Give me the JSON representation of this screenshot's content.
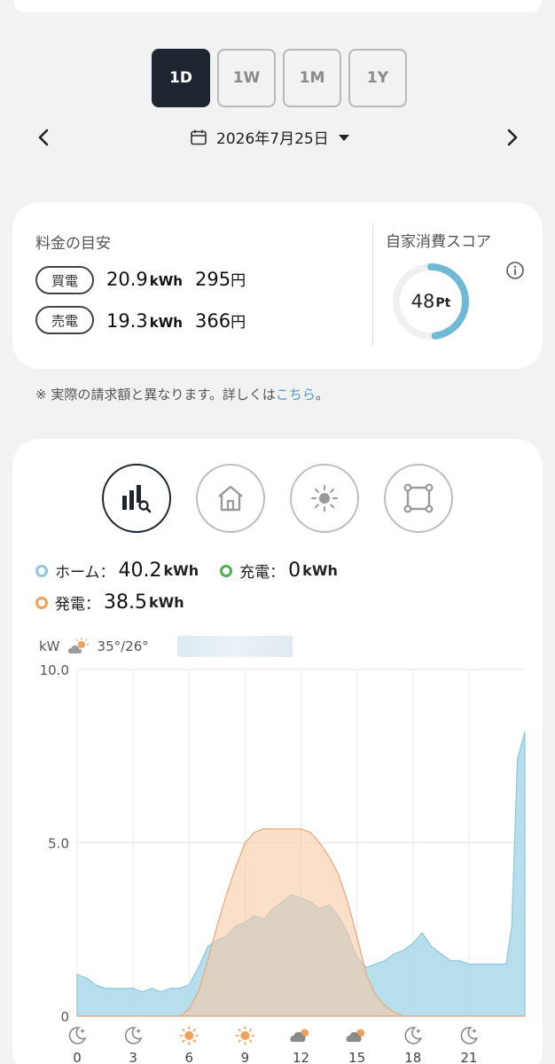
{
  "period_tabs": [
    {
      "label": "1D",
      "active": true
    },
    {
      "label": "1W",
      "active": false
    },
    {
      "label": "1M",
      "active": false
    },
    {
      "label": "1Y",
      "active": false
    }
  ],
  "date": {
    "text": "2026年7月25日"
  },
  "cost": {
    "title": "料金の目安",
    "buy": {
      "pill": "買電",
      "kwh": "20.9",
      "kwh_unit": "kWh",
      "yen": "295",
      "yen_unit": "円"
    },
    "sell": {
      "pill": "売電",
      "kwh": "19.3",
      "kwh_unit": "kWh",
      "yen": "366",
      "yen_unit": "円"
    }
  },
  "score": {
    "title": "自家消費スコア",
    "value": "48",
    "unit": "Pt",
    "ratio": 0.48
  },
  "note": {
    "text": "※ 実際の請求額と異なります。詳しくは",
    "link": "こちら",
    "suffix": "。"
  },
  "legend": {
    "home": {
      "label": "ホーム：",
      "value": "40.2",
      "unit": "kWh",
      "color": "#8cc8e0"
    },
    "charge": {
      "label": "充電：",
      "value": "0",
      "unit": "kWh",
      "color": "#4caf50"
    },
    "gen": {
      "label": "発電：",
      "value": "38.5",
      "unit": "kWh",
      "color": "#f0a05a"
    }
  },
  "weather": {
    "unit": "kW",
    "temps": "35°/26°"
  },
  "colors": {
    "home_fill": "#a9d8ea",
    "gen_fill": "#f6c9a5",
    "overlap": "#d8ccc0"
  },
  "chart_data": {
    "type": "area",
    "ylabel": "kW",
    "ylim": [
      0,
      10
    ],
    "y_ticks": [
      "10.0",
      "5.0",
      "0"
    ],
    "x_ticks": [
      "0",
      "3",
      "6",
      "9",
      "12",
      "15",
      "18",
      "21"
    ],
    "x_tick_weather": [
      "moon",
      "moon",
      "sun",
      "sun",
      "cloud-sun",
      "cloud-sun",
      "moon",
      "moon"
    ],
    "xlim": [
      0,
      24
    ],
    "series": [
      {
        "name": "ホーム",
        "x": [
          0,
          0.5,
          1,
          1.5,
          2,
          2.5,
          3,
          3.5,
          4,
          4.5,
          5,
          5.5,
          6,
          6.5,
          7,
          7.5,
          8,
          8.5,
          9,
          9.5,
          10,
          10.5,
          11,
          11.5,
          12,
          12.5,
          13,
          13.5,
          14,
          14.5,
          15,
          15.5,
          16,
          16.5,
          17,
          17.5,
          18,
          18.5,
          19,
          19.5,
          20,
          20.5,
          21,
          21.5,
          22,
          22.5,
          23,
          23.3,
          23.6,
          24
        ],
        "y": [
          1.2,
          1.1,
          0.9,
          0.8,
          0.8,
          0.8,
          0.8,
          0.7,
          0.8,
          0.7,
          0.8,
          0.8,
          0.9,
          1.4,
          2.0,
          2.2,
          2.3,
          2.6,
          2.7,
          2.9,
          2.8,
          3.1,
          3.3,
          3.5,
          3.4,
          3.3,
          3.1,
          3.2,
          2.9,
          2.4,
          1.7,
          1.4,
          1.5,
          1.6,
          1.8,
          1.9,
          2.1,
          2.4,
          2.0,
          1.8,
          1.6,
          1.6,
          1.5,
          1.5,
          1.5,
          1.5,
          1.5,
          2.6,
          7.4,
          8.2
        ]
      },
      {
        "name": "発電",
        "x": [
          0,
          5,
          5.5,
          6,
          6.5,
          7,
          7.5,
          8,
          8.5,
          9,
          9.5,
          10,
          10.5,
          11,
          11.5,
          12,
          12.5,
          13,
          13.5,
          14,
          14.5,
          15,
          15.5,
          16,
          16.5,
          17,
          17.5,
          18,
          24
        ],
        "y": [
          0,
          0,
          0,
          0.2,
          0.7,
          1.6,
          2.6,
          3.5,
          4.3,
          5.0,
          5.3,
          5.4,
          5.4,
          5.4,
          5.4,
          5.4,
          5.3,
          5.0,
          4.6,
          4.1,
          3.3,
          2.3,
          1.2,
          0.6,
          0.3,
          0.1,
          0,
          0,
          0
        ]
      }
    ]
  }
}
